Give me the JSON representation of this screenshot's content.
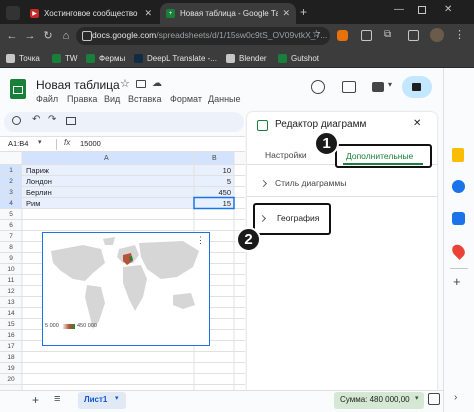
{
  "browser": {
    "tabs": [
      {
        "label": "Хостинговое сообщество «Ti"
      },
      {
        "label": "Новая таблица - Google Табли"
      }
    ],
    "new_tab": "+",
    "url_main": "docs.google.com",
    "url_rest": "/spreadsheets/d/1/15sw0c9tS_OV09vtkX_7...",
    "bookmarks": [
      "Точка",
      "TW",
      "Фермы",
      "DeepL Translate -...",
      "Blender",
      "Gutshot"
    ]
  },
  "sheets": {
    "title": "Новая таблица",
    "menu": [
      "Файл",
      "Правка",
      "Вид",
      "Вставка",
      "Формат",
      "Данные"
    ],
    "name_box": "A1:B4",
    "formula_value": "15000",
    "col_a": "A",
    "col_b": "B",
    "rows": [
      {
        "n": "1",
        "a": "Париж",
        "b": "10"
      },
      {
        "n": "2",
        "a": "Лондон",
        "b": "5"
      },
      {
        "n": "3",
        "a": "Берлин",
        "b": "450"
      },
      {
        "n": "4",
        "a": "Рим",
        "b": "15"
      }
    ],
    "empty_rows": [
      "5",
      "6",
      "7",
      "8",
      "9",
      "10",
      "11",
      "12",
      "13",
      "14",
      "15",
      "16",
      "17",
      "18",
      "19",
      "20"
    ],
    "chart_legend_min": "5 000",
    "chart_legend_max": "450 000",
    "sheet_tab": "Лист1",
    "sum_label": "Сумма: 480 000,00"
  },
  "editor": {
    "title": "Редактор диаграмм",
    "tab_setup": "Настройки",
    "tab_customize": "Дополнительные",
    "section_style": "Стиль диаграммы",
    "section_geo": "География"
  },
  "callouts": {
    "one": "1",
    "two": "2"
  }
}
